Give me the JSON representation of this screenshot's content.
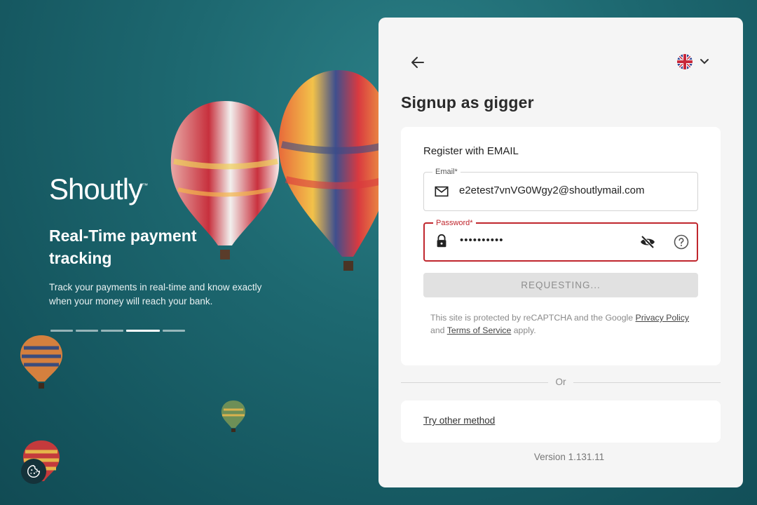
{
  "hero": {
    "logo": "Shoutly",
    "logo_tm": "™",
    "title": "Real-Time payment tracking",
    "text": "Track your payments in real-time and know exactly when your money will reach your bank.",
    "carousel_total": 5,
    "carousel_active": 4
  },
  "panel": {
    "title": "Signup as gigger",
    "language_icon": "uk-flag-icon",
    "card": {
      "title": "Register with EMAIL",
      "email": {
        "label": "Email*",
        "value": "e2etest7vnVG0Wgy2@shoutlymail.com"
      },
      "password": {
        "label": "Password*",
        "value": "••••••••••"
      },
      "submit_label": "REQUESTING...",
      "recaptcha": {
        "prefix": "This site is protected by reCAPTCHA and the Google ",
        "privacy": "Privacy Policy",
        "and": " and ",
        "terms": "Terms of Service",
        "suffix": " apply."
      }
    },
    "divider": "Or",
    "alt_method": "Try other method",
    "version": "Version 1.131.11"
  },
  "colors": {
    "background": "#1d6870",
    "error": "#c0262d",
    "panel": "#f5f5f5"
  }
}
